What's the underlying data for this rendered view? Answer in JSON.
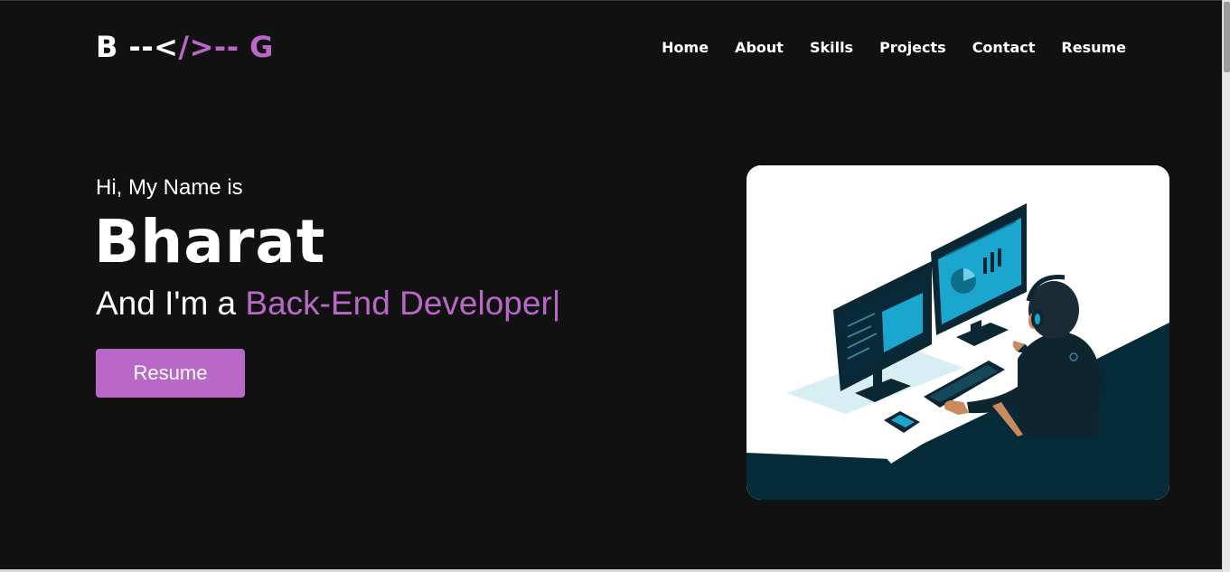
{
  "nav": {
    "logo_left": "B --<",
    "logo_accent": "/>-- G",
    "items": [
      "Home",
      "About",
      "Skills",
      "Projects",
      "Contact",
      "Resume"
    ]
  },
  "hero": {
    "greeting": "Hi, My Name is",
    "name": "Bharat",
    "role_prefix": "And I'm a",
    "role_accent": "Back-End Developer|",
    "button": "Resume"
  },
  "colors": {
    "background": "#111111",
    "accent": "#b968c7",
    "text": "#ffffff"
  }
}
